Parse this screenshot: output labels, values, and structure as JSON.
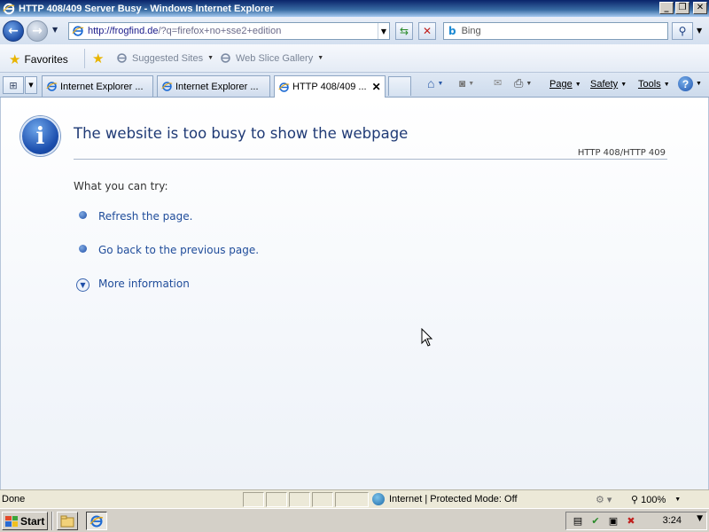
{
  "window": {
    "title": "HTTP 408/409 Server Busy - Windows Internet Explorer",
    "minimize": "_",
    "restore": "❐",
    "close": "✕"
  },
  "navigation": {
    "url_host": "http://frogfind.de",
    "url_path": "/?q=firefox+no+sse2+edition",
    "search_placeholder": "Bing",
    "search_engine_icon": "bing-icon"
  },
  "favorites_bar": {
    "favorites_label": "Favorites",
    "suggested_sites": "Suggested Sites",
    "web_slice_gallery": "Web Slice Gallery"
  },
  "tabs": [
    {
      "label": "Internet Explorer ..."
    },
    {
      "label": "Internet Explorer ..."
    },
    {
      "label": "HTTP 408/409 ..."
    }
  ],
  "command_bar": {
    "page": "Page",
    "safety": "Safety",
    "tools": "Tools"
  },
  "content": {
    "title": "The website is too busy to show the webpage",
    "code": "HTTP 408/HTTP 409",
    "what_you_can_try": "What you can try:",
    "refresh": "Refresh the page.",
    "go_back": "Go back to the previous page.",
    "more_info": "More information"
  },
  "status_bar": {
    "status": "Done",
    "zone": "Internet | Protected Mode: Off",
    "zoom": "100%"
  },
  "taskbar": {
    "start": "Start",
    "clock": "3:24"
  },
  "colors": {
    "title_text": "#1f3a75",
    "link": "#1f4c9a",
    "titlebar": "#0a246a"
  }
}
